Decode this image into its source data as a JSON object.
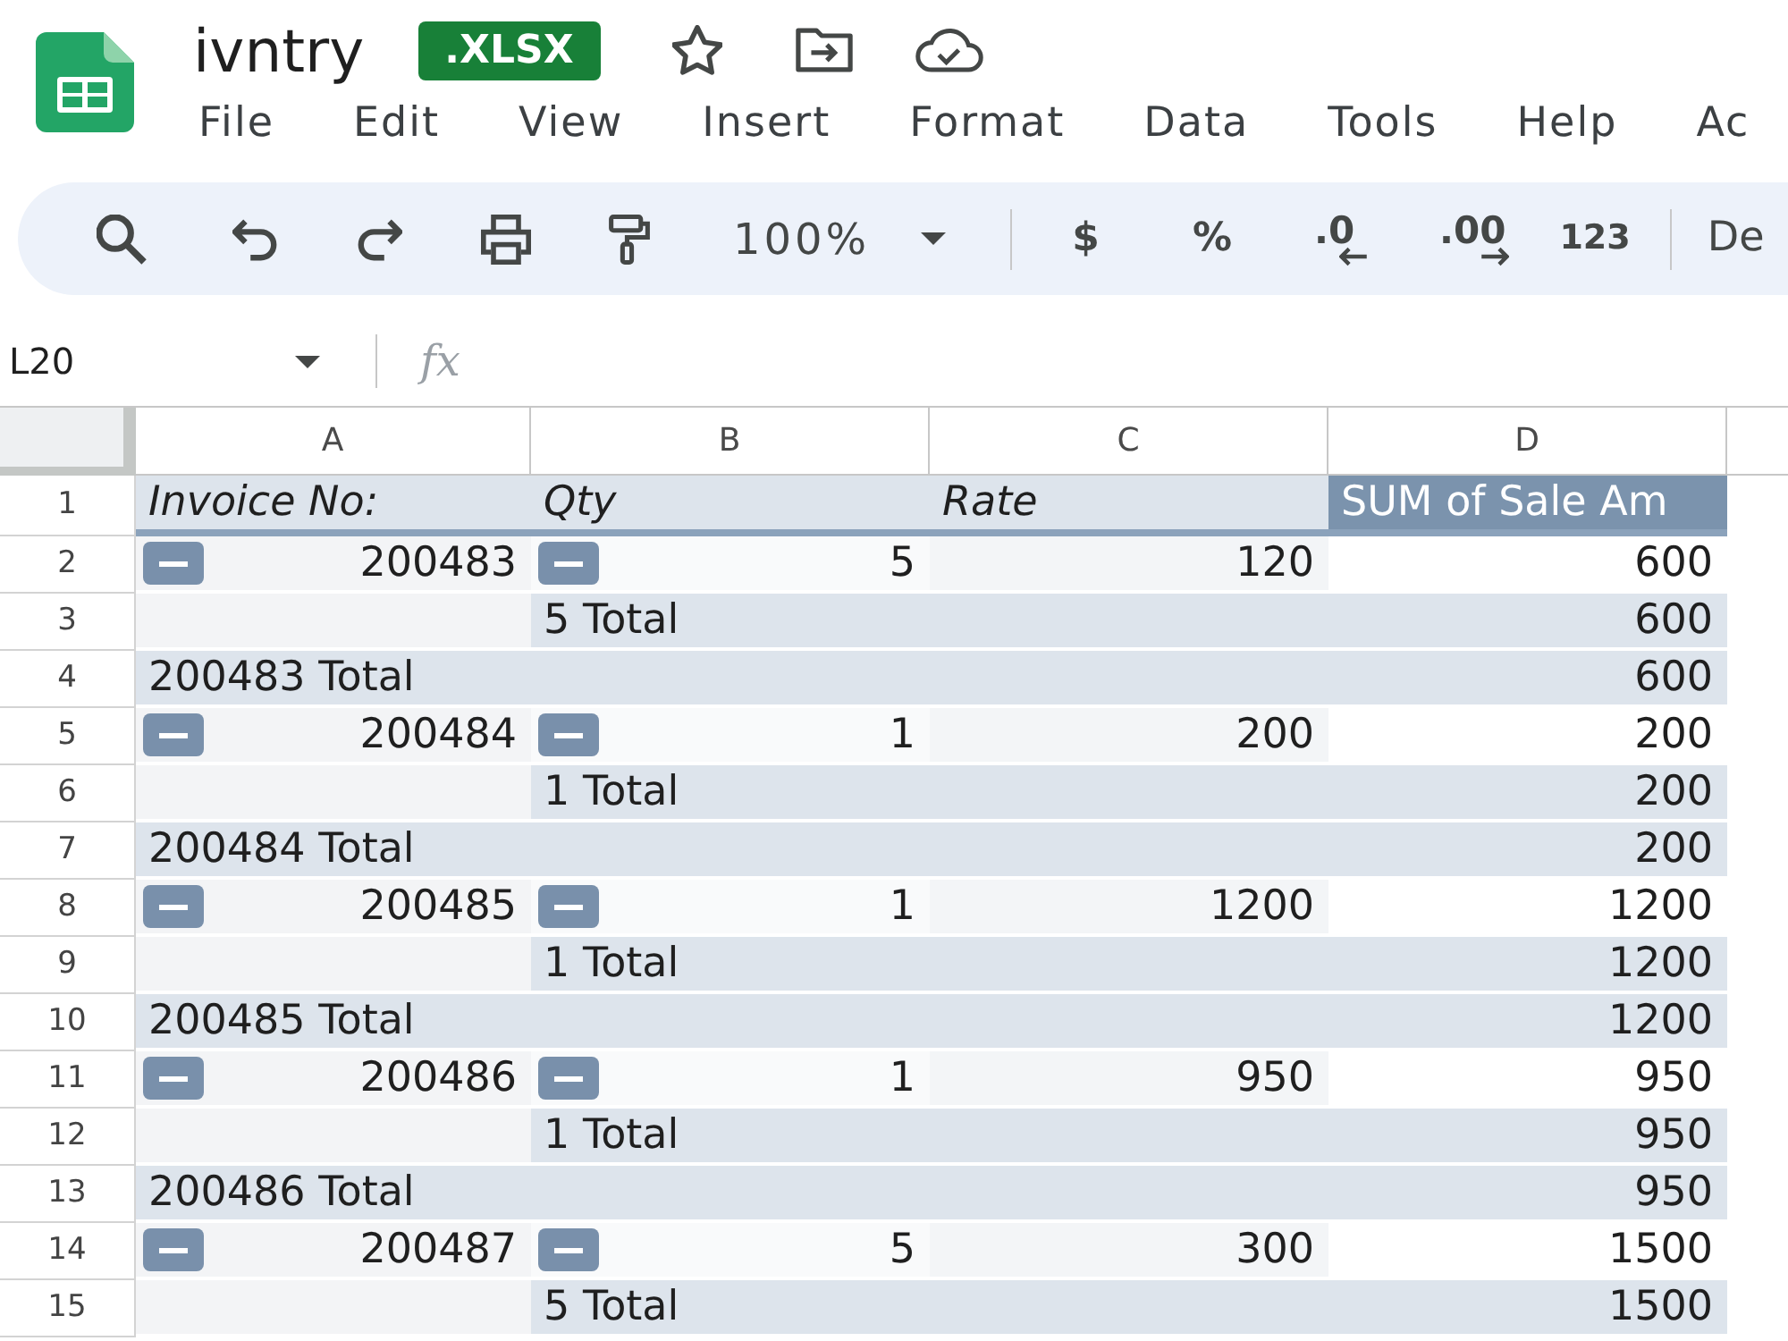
{
  "app": {
    "document_title": "ivntry",
    "file_badge": ".XLSX"
  },
  "menu": [
    "File",
    "Edit",
    "View",
    "Insert",
    "Format",
    "Data",
    "Tools",
    "Help",
    "Ac"
  ],
  "toolbar": {
    "zoom": "100%",
    "currency": "$",
    "percent": "%",
    "decrease_decimal": ".0",
    "increase_decimal": ".00",
    "number_format": "123",
    "font": "De"
  },
  "formula_bar": {
    "cell_reference": "L20",
    "function_label": "fx"
  },
  "sheet": {
    "columns": [
      "A",
      "B",
      "C",
      "D"
    ],
    "header_row": {
      "number": "1",
      "cells": [
        {
          "text": "Invoice No:",
          "kind": "row_field"
        },
        {
          "text": "Qty",
          "kind": "row_field"
        },
        {
          "text": "Rate",
          "kind": "row_field"
        },
        {
          "text": "SUM of Sale Am",
          "kind": "value_field"
        }
      ]
    },
    "rows": [
      {
        "kind": "detail",
        "number": "2",
        "invoice": "200483",
        "invoice_expanded": true,
        "qty": "5",
        "qty_expanded": true,
        "rate": "120",
        "amount": "600"
      },
      {
        "kind": "subtotal",
        "number": "3",
        "label": "5 Total",
        "amount": "600"
      },
      {
        "kind": "total",
        "number": "4",
        "label": "200483 Total",
        "amount": "600"
      },
      {
        "kind": "detail",
        "number": "5",
        "invoice": "200484",
        "invoice_expanded": true,
        "qty": "1",
        "qty_expanded": true,
        "rate": "200",
        "amount": "200"
      },
      {
        "kind": "subtotal",
        "number": "6",
        "label": "1 Total",
        "amount": "200"
      },
      {
        "kind": "total",
        "number": "7",
        "label": "200484 Total",
        "amount": "200"
      },
      {
        "kind": "detail",
        "number": "8",
        "invoice": "200485",
        "invoice_expanded": true,
        "qty": "1",
        "qty_expanded": true,
        "rate": "1200",
        "amount": "1200"
      },
      {
        "kind": "subtotal",
        "number": "9",
        "label": "1 Total",
        "amount": "1200"
      },
      {
        "kind": "total",
        "number": "10",
        "label": "200485 Total",
        "amount": "1200"
      },
      {
        "kind": "detail",
        "number": "11",
        "invoice": "200486",
        "invoice_expanded": true,
        "qty": "1",
        "qty_expanded": true,
        "rate": "950",
        "amount": "950"
      },
      {
        "kind": "subtotal",
        "number": "12",
        "label": "1 Total",
        "amount": "950"
      },
      {
        "kind": "total",
        "number": "13",
        "label": "200486 Total",
        "amount": "950"
      },
      {
        "kind": "detail",
        "number": "14",
        "invoice": "200487",
        "invoice_expanded": true,
        "qty": "5",
        "qty_expanded": true,
        "rate": "300",
        "amount": "1500"
      },
      {
        "kind": "subtotal",
        "number": "15",
        "label": "5 Total",
        "amount": "1500"
      }
    ]
  }
}
